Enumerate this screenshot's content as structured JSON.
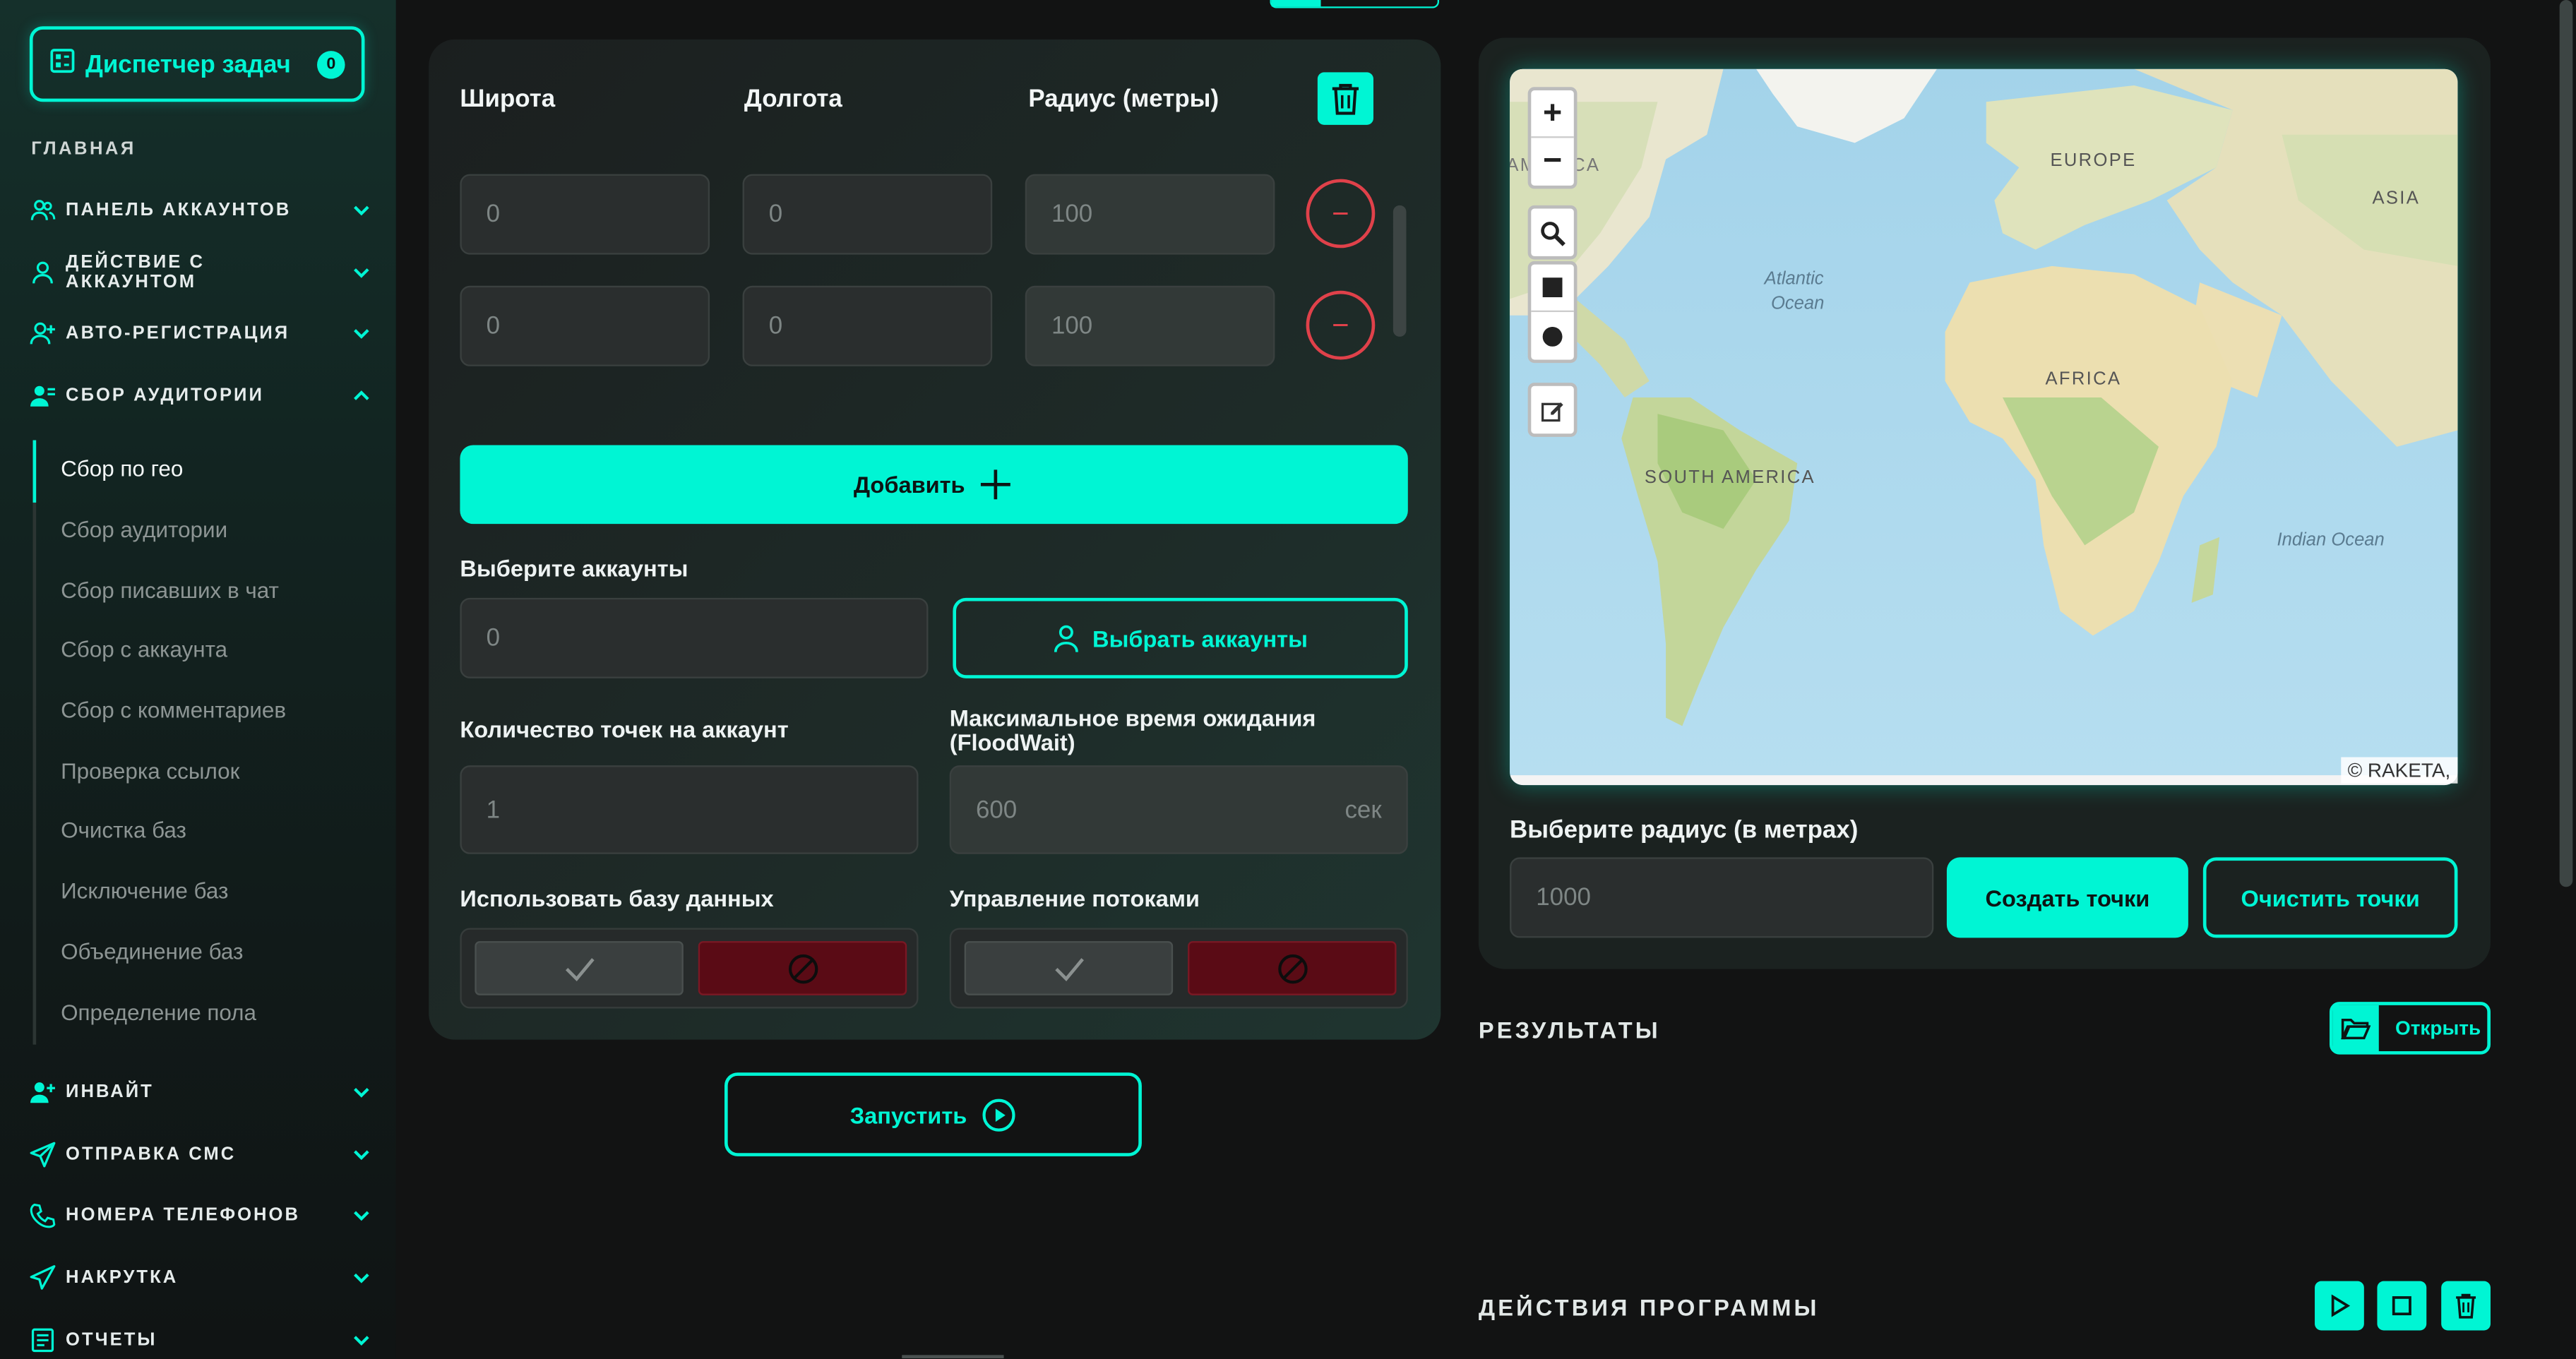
{
  "sidebar": {
    "dispatcher_label": "Диспетчер задач",
    "dispatcher_count": "0",
    "main_section": "ГЛАВНАЯ",
    "nav": [
      {
        "label": "ПАНЕЛЬ АККАУНТОВ"
      },
      {
        "label": "ДЕЙСТВИЕ С АККАУНТОМ"
      },
      {
        "label": "АВТО-РЕГИСТРАЦИЯ"
      },
      {
        "label": "СБОР АУДИТОРИИ"
      },
      {
        "label": "ИНВАЙТ"
      },
      {
        "label": "ОТПРАВКА СМС"
      },
      {
        "label": "НОМЕРА ТЕЛЕФОНОВ"
      },
      {
        "label": "НАКРУТКА"
      },
      {
        "label": "ОТЧЕТЫ"
      }
    ],
    "submenu": [
      {
        "label": "Сбор по гео"
      },
      {
        "label": "Сбор аудитории"
      },
      {
        "label": "Сбор писавших в чат"
      },
      {
        "label": "Сбор с аккаунта"
      },
      {
        "label": "Сбор с комментариев"
      },
      {
        "label": "Проверка ссылок"
      },
      {
        "label": "Очистка баз"
      },
      {
        "label": "Исключение баз"
      },
      {
        "label": "Объединение баз"
      },
      {
        "label": "Определение пола"
      }
    ]
  },
  "geo": {
    "col_lat": "Широта",
    "col_lon": "Долгота",
    "col_radius": "Радиус (метры)",
    "rows": [
      {
        "lat": "0",
        "lon": "0",
        "radius": "100"
      },
      {
        "lat": "0",
        "lon": "0",
        "radius": "100"
      }
    ],
    "remove_symbol": "−",
    "add_label": "Добавить"
  },
  "accounts": {
    "label": "Выберите аккаунты",
    "value": "0",
    "select_label": "Выбрать аккаунты"
  },
  "points_per_account": {
    "label": "Количество точек на аккаунт",
    "value": "1"
  },
  "floodwait": {
    "label": "Максимальное время ожидания (FloodWait)",
    "value": "600",
    "suffix": "сек"
  },
  "use_db": {
    "label": "Использовать базу данных"
  },
  "threads": {
    "label": "Управление потоками"
  },
  "run_label": "Запустить",
  "map": {
    "attribution": "© RAKETA,",
    "places": {
      "america": "AMERICA",
      "europe": "EUROPE",
      "asia": "ASIA",
      "atlantic1": "Atlantic",
      "atlantic2": "Ocean",
      "africa": "AFRICA",
      "south_america": "SOUTH AMERICA",
      "indian": "Indian Ocean"
    }
  },
  "radius_picker": {
    "label": "Выберите радиус (в метрах)",
    "placeholder": "1000",
    "create_label": "Создать точки",
    "clear_label": "Очистить точки"
  },
  "results": {
    "title": "РЕЗУЛЬТАТЫ",
    "open_label": "Открыть"
  },
  "actions": {
    "title": "ДЕЙСТВИЯ ПРОГРАММЫ"
  },
  "colors": {
    "accent": "#00F5D4",
    "danger": "#E0414A",
    "background": "#121313"
  }
}
